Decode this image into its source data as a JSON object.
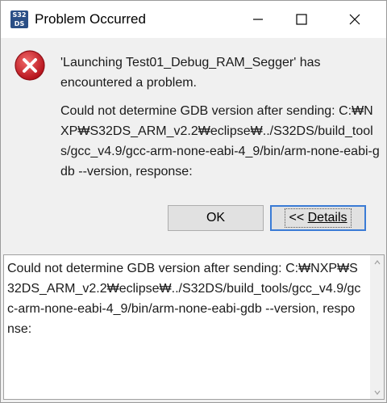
{
  "window": {
    "title": "Problem Occurred",
    "app_icon_text": [
      "S32",
      "DS"
    ]
  },
  "message": {
    "title": "'Launching Test01_Debug_RAM_Segger' has encountered a problem.",
    "body": "Could not determine GDB version after sending: C:₩NXP₩S32DS_ARM_v2.2₩eclipse₩../S32DS/build_tools/gcc_v4.9/gcc-arm-none-eabi-4_9/bin/arm-none-eabi-gdb --version, response:"
  },
  "buttons": {
    "ok_label": "OK",
    "details_prefix": "<< ",
    "details_label": "Details",
    "details_mnemonic": "D"
  },
  "details": {
    "text": "Could not determine GDB version after sending: C:₩NXP₩S32DS_ARM_v2.2₩eclipse₩../S32DS/build_tools/gcc_v4.9/gcc-arm-none-eabi-4_9/bin/arm-none-eabi-gdb --version, response:"
  },
  "icons": {
    "app": "s32ds-app-icon",
    "error": "error-icon",
    "minimize": "minimize-icon",
    "maximize": "maximize-icon",
    "close": "close-icon",
    "scroll_up": "chevron-up-icon",
    "scroll_down": "chevron-down-icon"
  },
  "colors": {
    "error_red": "#c8232c",
    "focus_blue": "#3a7bd5",
    "app_icon_bg": "#2a4f86"
  }
}
